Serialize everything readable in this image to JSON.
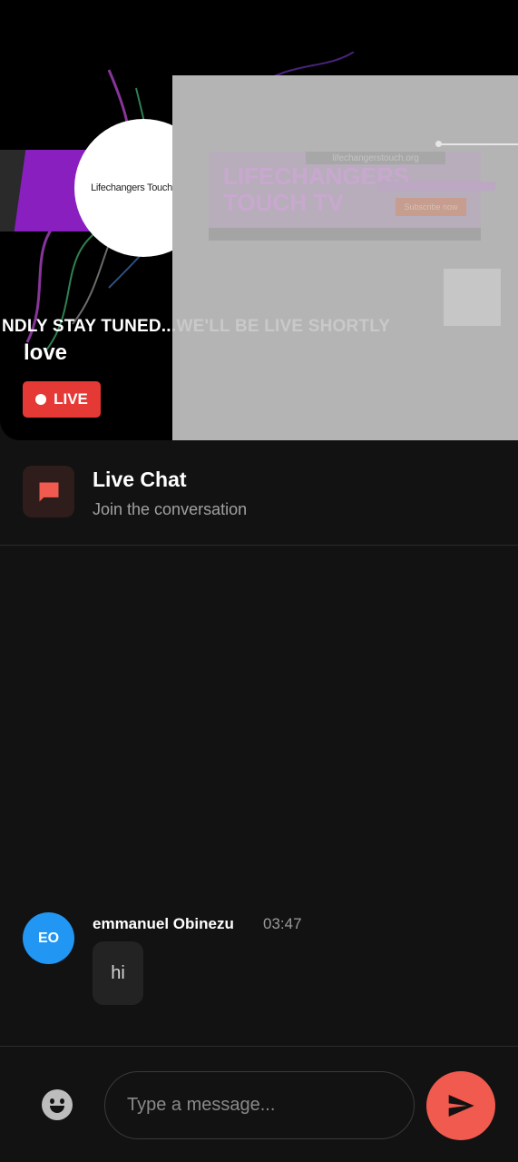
{
  "video": {
    "ticker_left": "NDLY STAY TUNED...",
    "ticker_right": ".WE'LL BE LIVE SHORTLY",
    "stream_title": "love",
    "live_label": "LIVE",
    "logo_text": "Lifechangers Touch",
    "overlay_title": "LIFECHANGERS TOUCH TV",
    "overlay_url": "lifechangerstouch.org",
    "overlay_button": "Subscribe now"
  },
  "chat_header": {
    "title": "Live Chat",
    "subtitle": "Join the conversation",
    "icon": "chat-bubble-icon"
  },
  "messages": [
    {
      "initials": "EO",
      "name": "emmanuel Obinezu",
      "time": "03:47",
      "text": "hi"
    }
  ],
  "input": {
    "placeholder": "Type a message...",
    "emoji_icon": "emoji-icon",
    "send_icon": "send-icon"
  },
  "colors": {
    "background": "#121212",
    "live_red": "#e53935",
    "send_coral": "#f15a4e",
    "avatar_blue": "#2196f3",
    "brand_purple": "#8a1fc0"
  }
}
